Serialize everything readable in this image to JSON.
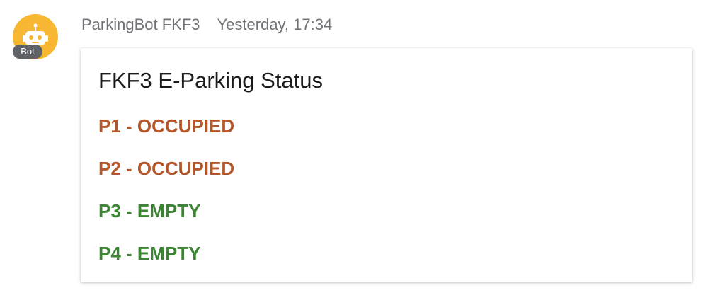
{
  "sender": {
    "name": "ParkingBot FKF3",
    "timestamp": "Yesterday, 17:34",
    "badge": "Bot",
    "avatar_icon": "robot-icon",
    "avatar_color": "#f7b733"
  },
  "card": {
    "title": "FKF3 E-Parking Status",
    "items": [
      {
        "text": "P1 - OCCUPIED",
        "status": "occupied",
        "color": "#b5562a"
      },
      {
        "text": "P2 - OCCUPIED",
        "status": "occupied",
        "color": "#b5562a"
      },
      {
        "text": "P3 - EMPTY",
        "status": "empty",
        "color": "#3c8533"
      },
      {
        "text": "P4 - EMPTY",
        "status": "empty",
        "color": "#3c8533"
      }
    ]
  }
}
